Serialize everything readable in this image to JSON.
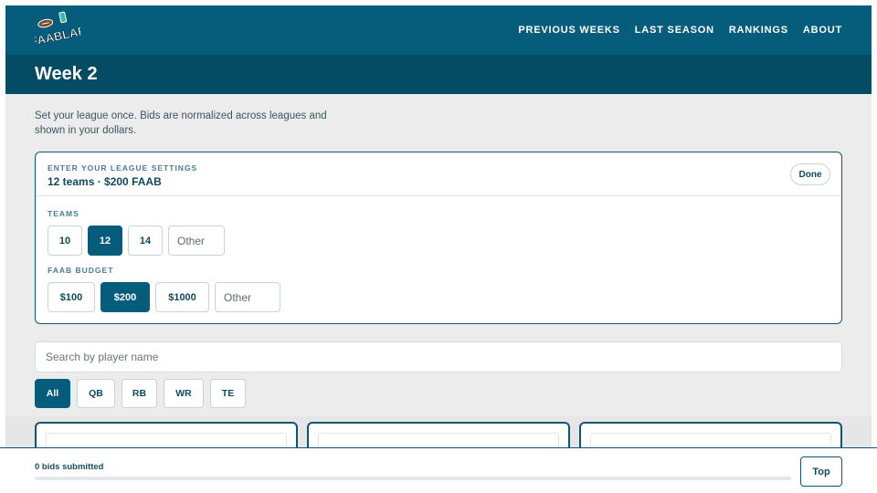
{
  "header": {
    "logo_text": "FAABLAB",
    "nav": [
      "PREVIOUS WEEKS",
      "LAST SEASON",
      "RANKINGS",
      "ABOUT"
    ]
  },
  "page_title": "Week 2",
  "intro_text": "Set your league once. Bids are normalized across leagues and shown in your dollars.",
  "settings": {
    "eyebrow": "ENTER YOUR LEAGUE SETTINGS",
    "summary": "12 teams · $200 FAAB",
    "done_label": "Done",
    "teams_label": "TEAMS",
    "teams_options": [
      "10",
      "12",
      "14"
    ],
    "teams_selected": "12",
    "teams_other_placeholder": "Other",
    "budget_label": "FAAB BUDGET",
    "budget_options": [
      "$100",
      "$200",
      "$1000"
    ],
    "budget_selected": "$200",
    "budget_other_placeholder": "Other"
  },
  "search": {
    "placeholder": "Search by player name"
  },
  "positions": {
    "options": [
      "All",
      "QB",
      "RB",
      "WR",
      "TE"
    ],
    "selected": "All"
  },
  "footer": {
    "bids_text": "0 bids submitted",
    "progress": 0,
    "top_label": "Top"
  },
  "colors": {
    "primary": "#065d7b",
    "primary_dark": "#034c63",
    "background": "#ececec"
  }
}
